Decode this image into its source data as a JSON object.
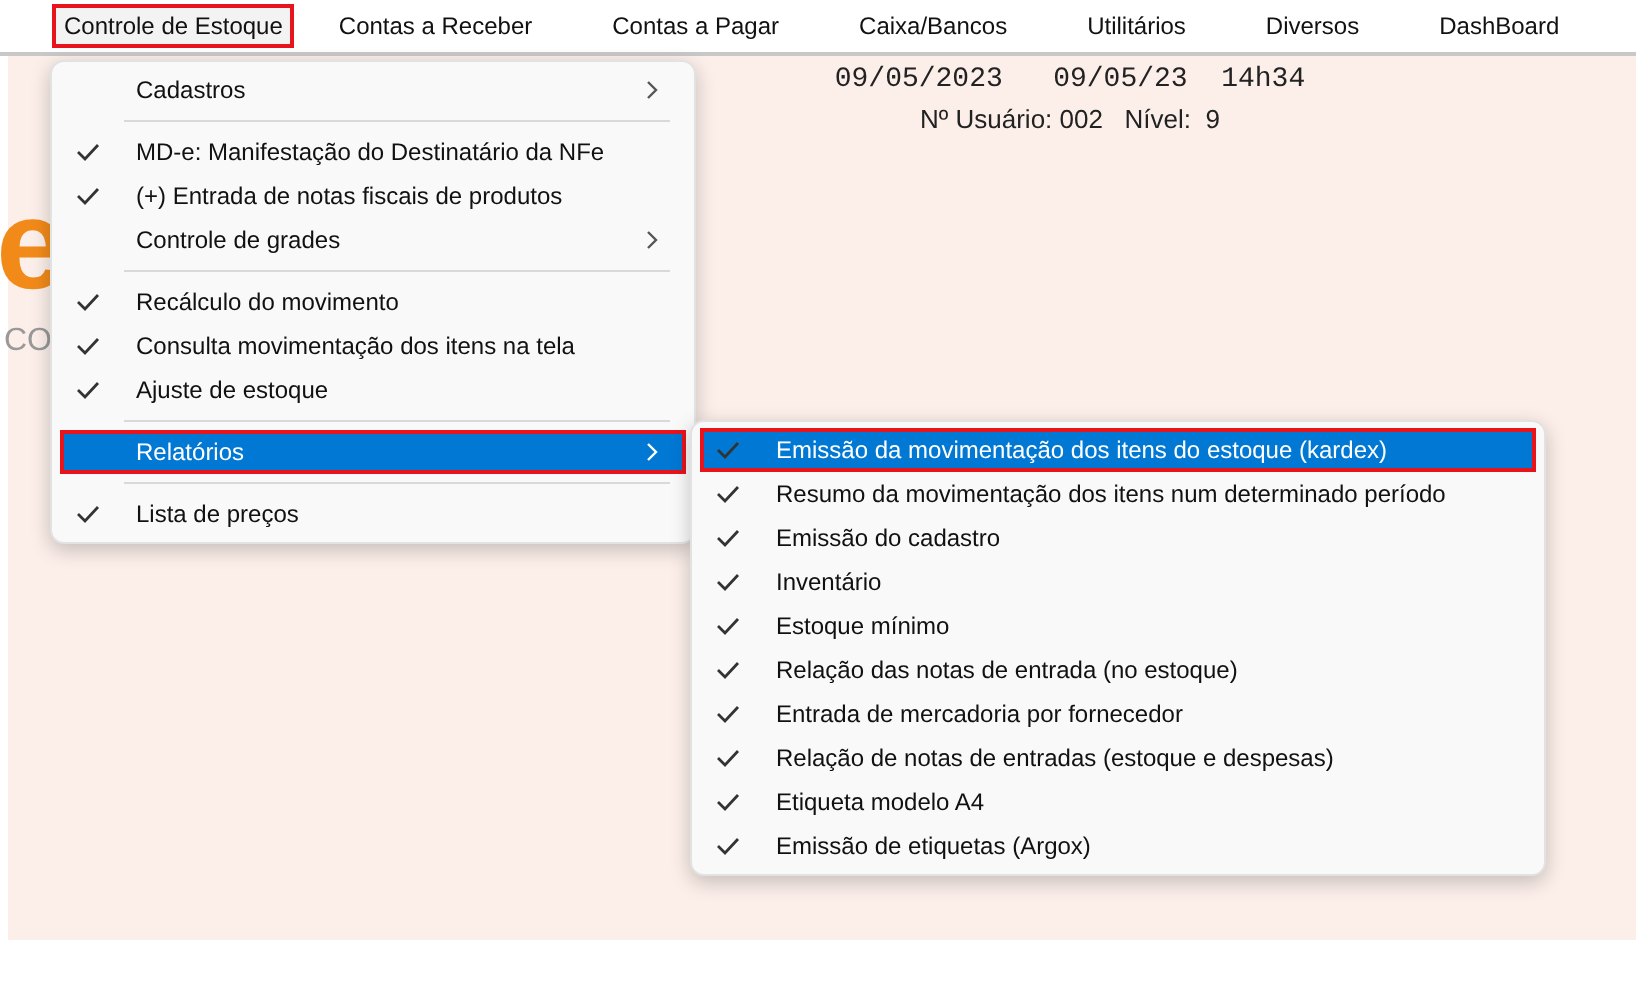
{
  "menubar": [
    {
      "label": "Controle de Estoque",
      "selected": true,
      "highlighted": true
    },
    {
      "label": "Contas a Receber",
      "selected": false,
      "highlighted": false
    },
    {
      "label": "Contas a Pagar",
      "selected": false,
      "highlighted": false
    },
    {
      "label": "Caixa/Bancos",
      "selected": false,
      "highlighted": false
    },
    {
      "label": "Utilitários",
      "selected": false,
      "highlighted": false
    },
    {
      "label": "Diversos",
      "selected": false,
      "highlighted": false
    },
    {
      "label": "DashBoard",
      "selected": false,
      "highlighted": false
    }
  ],
  "background": {
    "logo_fragment": "e",
    "tagline_fragment": "CO"
  },
  "header": {
    "dates": "09/05/2023   09/05/23  14h34",
    "user_line": "Nº Usuário: 002   Nível:  9"
  },
  "dropdown": {
    "items": [
      {
        "kind": "submenu",
        "label": "Cadastros",
        "checked": false,
        "selected": false,
        "highlighted": false
      },
      {
        "kind": "separator"
      },
      {
        "kind": "item",
        "label": "MD-e: Manifestação do Destinatário da NFe",
        "checked": true,
        "selected": false,
        "highlighted": false
      },
      {
        "kind": "item",
        "label": "(+) Entrada de notas fiscais de produtos",
        "checked": true,
        "selected": false,
        "highlighted": false
      },
      {
        "kind": "submenu",
        "label": "Controle de grades",
        "checked": false,
        "selected": false,
        "highlighted": false
      },
      {
        "kind": "separator"
      },
      {
        "kind": "item",
        "label": "Recálculo do movimento",
        "checked": true,
        "selected": false,
        "highlighted": false
      },
      {
        "kind": "item",
        "label": "Consulta movimentação dos itens na tela",
        "checked": true,
        "selected": false,
        "highlighted": false
      },
      {
        "kind": "item",
        "label": "Ajuste de estoque",
        "checked": true,
        "selected": false,
        "highlighted": false
      },
      {
        "kind": "separator"
      },
      {
        "kind": "submenu",
        "label": "Relatórios",
        "checked": false,
        "selected": true,
        "highlighted": true
      },
      {
        "kind": "separator"
      },
      {
        "kind": "item",
        "label": "Lista de preços",
        "checked": true,
        "selected": false,
        "highlighted": false
      }
    ]
  },
  "submenu": {
    "items": [
      {
        "kind": "item",
        "label": "Emissão da movimentação dos itens do estoque (kardex)",
        "checked": true,
        "selected": true,
        "highlighted": true
      },
      {
        "kind": "item",
        "label": "Resumo da movimentação dos itens num determinado período",
        "checked": true,
        "selected": false,
        "highlighted": false
      },
      {
        "kind": "item",
        "label": "Emissão do cadastro",
        "checked": true,
        "selected": false,
        "highlighted": false
      },
      {
        "kind": "item",
        "label": "Inventário",
        "checked": true,
        "selected": false,
        "highlighted": false
      },
      {
        "kind": "item",
        "label": "Estoque mínimo",
        "checked": true,
        "selected": false,
        "highlighted": false
      },
      {
        "kind": "item",
        "label": "Relação das notas de entrada (no estoque)",
        "checked": true,
        "selected": false,
        "highlighted": false
      },
      {
        "kind": "item",
        "label": "Entrada de mercadoria por fornecedor",
        "checked": true,
        "selected": false,
        "highlighted": false
      },
      {
        "kind": "item",
        "label": "Relação de notas de entradas (estoque e despesas)",
        "checked": true,
        "selected": false,
        "highlighted": false
      },
      {
        "kind": "item",
        "label": "Etiqueta modelo A4",
        "checked": true,
        "selected": false,
        "highlighted": false
      },
      {
        "kind": "item",
        "label": "Emissão de etiquetas (Argox)",
        "checked": true,
        "selected": false,
        "highlighted": false
      }
    ]
  }
}
